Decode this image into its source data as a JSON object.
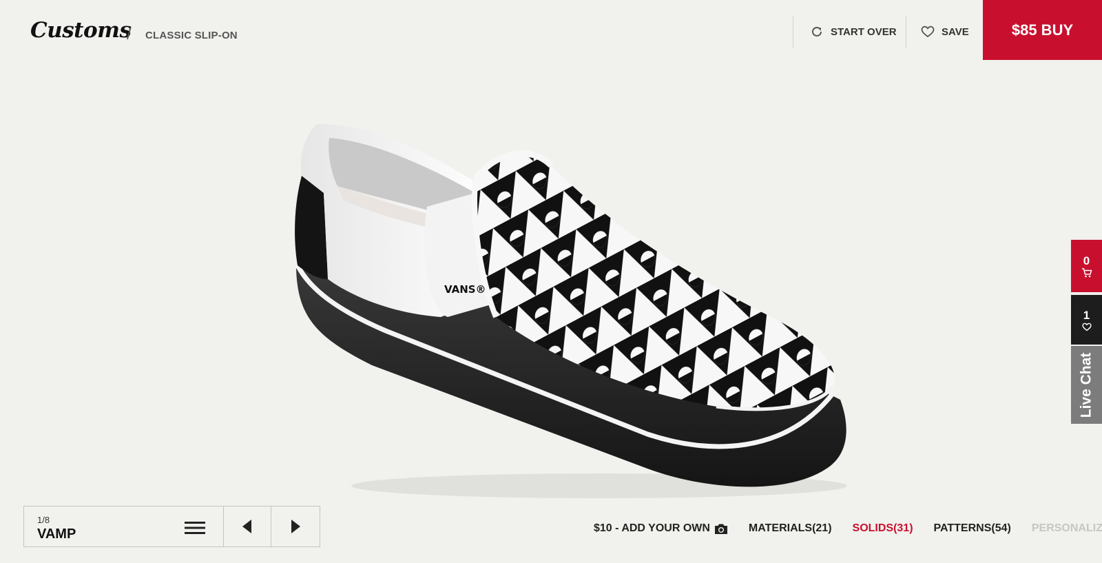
{
  "header": {
    "logo": "Customs",
    "separator": "/",
    "product_name": "CLASSIC SLIP-ON",
    "start_over_label": "START OVER",
    "save_label": "SAVE",
    "buy_label": "$85 BUY"
  },
  "shoe": {
    "brand_label": "VANS®",
    "pattern_colors": {
      "dark": "#111111",
      "light": "#ffffff"
    }
  },
  "rail": {
    "cart_count": "0",
    "favorites_count": "1",
    "live_chat_label": "Live Chat"
  },
  "navigator": {
    "step": "1/8",
    "part": "VAMP"
  },
  "tabs": {
    "add_your_own": "$10 - ADD YOUR OWN",
    "materials": "MATERIALS(21)",
    "solids": "SOLIDS(31)",
    "patterns": "PATTERNS(54)",
    "personalize": "PERSONALIZE"
  },
  "colors": {
    "accent": "#c8102e",
    "background": "#f1f1ed",
    "rail_dark": "#1d1d1d",
    "rail_gray": "#7c7c7c",
    "disabled_text": "#c6c6c2"
  }
}
